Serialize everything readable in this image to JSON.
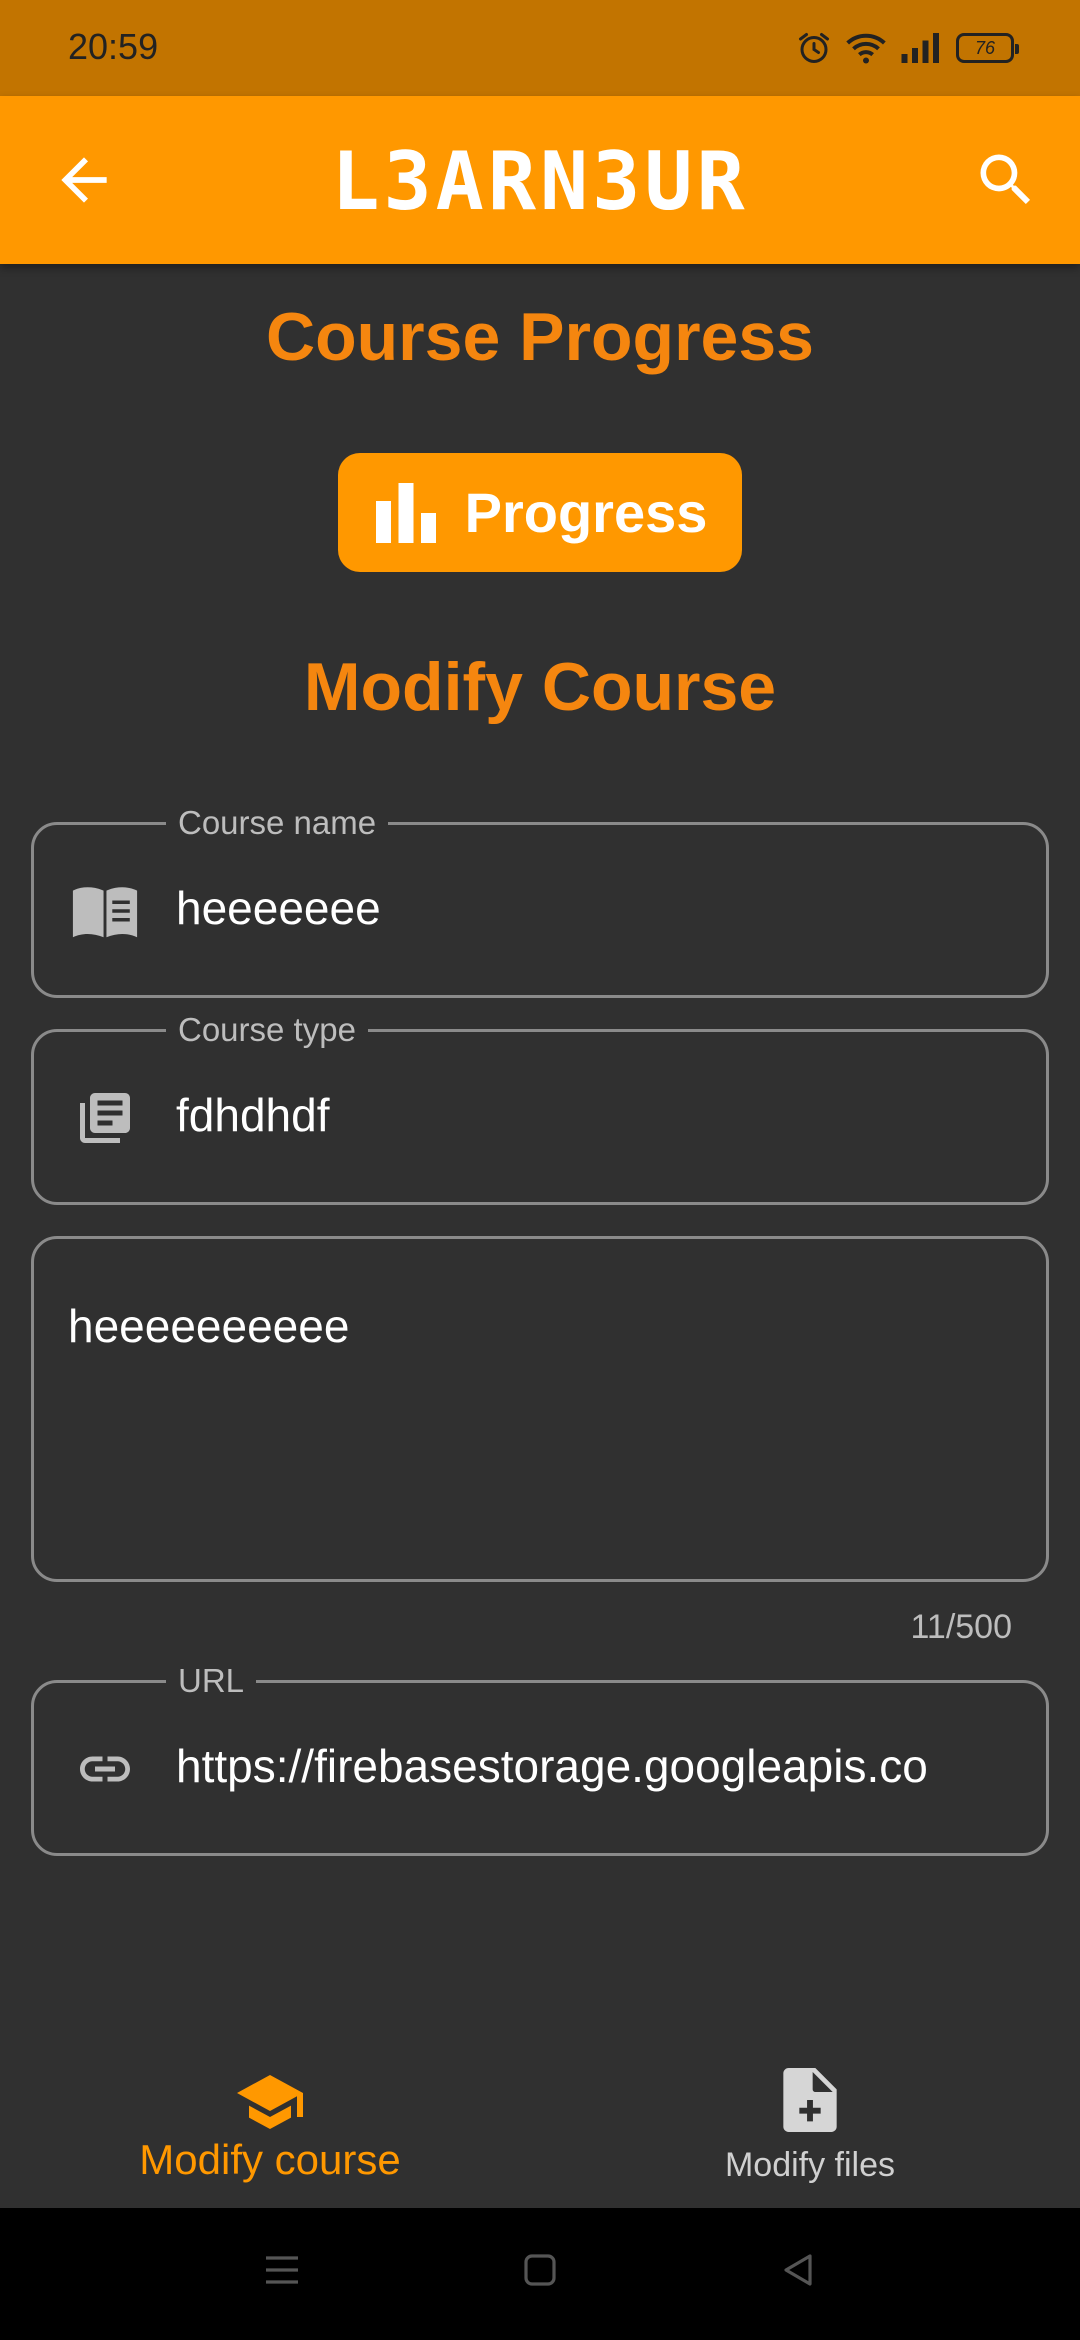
{
  "status_bar": {
    "time": "20:59",
    "battery": "76",
    "icons": [
      "alarm-icon",
      "wifi-icon",
      "signal-icon",
      "battery-icon"
    ]
  },
  "app_bar": {
    "title": "L3ARN3UR",
    "back_icon": "arrow-left-icon",
    "search_icon": "search-icon",
    "background": "#ff9800"
  },
  "progress_section": {
    "heading": "Course Progress",
    "button_label": "Progress",
    "button_icon": "bar-chart-icon"
  },
  "modify_section": {
    "heading": "Modify Course",
    "fields": {
      "course_name": {
        "label": "Course name",
        "value": "heeeeeee",
        "icon": "book-open-icon"
      },
      "course_type": {
        "label": "Course type",
        "value": "fdhdhdf",
        "icon": "library-books-icon"
      },
      "description": {
        "value": "heeeeeeeeee",
        "counter": "11/500"
      },
      "url": {
        "label": "URL",
        "value": "https://firebasestorage.googleapis.co",
        "icon": "link-icon"
      }
    }
  },
  "bottom_nav": {
    "items": [
      {
        "label": "Modify course",
        "icon": "graduation-cap-icon",
        "active": true
      },
      {
        "label": "Modify files",
        "icon": "file-add-icon",
        "active": false
      }
    ]
  },
  "colors": {
    "accent": "#ff9800",
    "heading": "#f5860f",
    "background": "#303030",
    "status_bar": "#c27400"
  }
}
